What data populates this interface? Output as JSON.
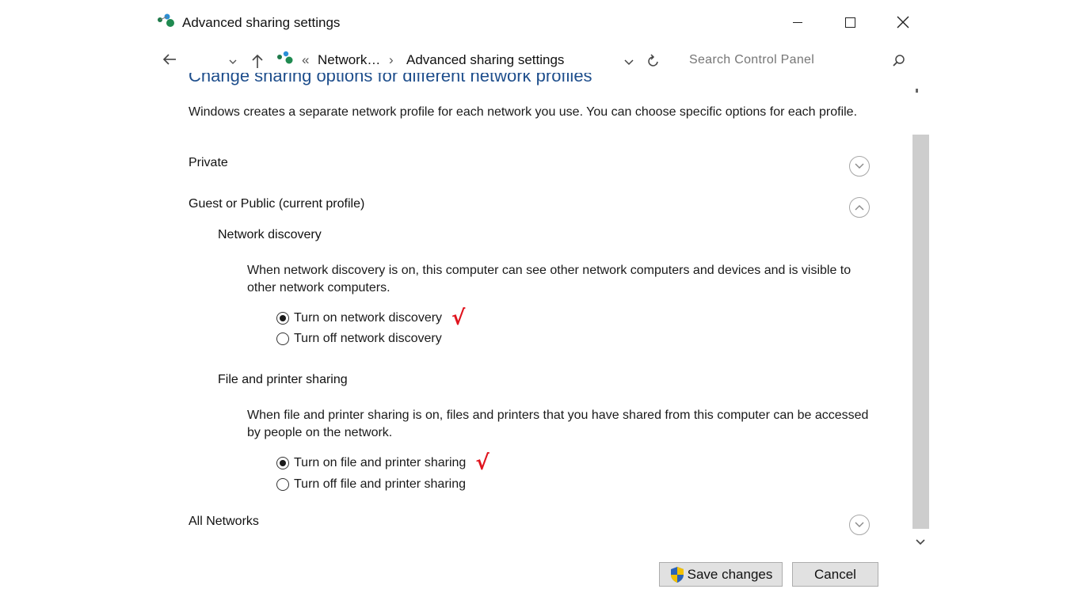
{
  "window": {
    "title": "Advanced sharing settings",
    "icon": "network-sharing-icon",
    "controls": [
      "minimize-icon",
      "maximize-icon",
      "close-icon"
    ]
  },
  "address_bar": {
    "overflow": "«",
    "crumbs": [
      "Network…",
      "Advanced sharing settings"
    ],
    "separator": "›",
    "search_placeholder": "Search Control Panel"
  },
  "page": {
    "heading": "Change sharing options for different network profiles",
    "intro": "Windows creates a separate network profile for each network you use. You can choose specific options for each profile.",
    "profiles": {
      "private": "Private",
      "guest": "Guest or Public (current profile)",
      "all": "All Networks"
    },
    "network_discovery": {
      "title": "Network discovery",
      "description": "When network discovery is on, this computer can see other network computers and devices and is visible to other network computers.",
      "option_on": "Turn on network discovery",
      "option_off": "Turn off network discovery",
      "selected": "on"
    },
    "file_sharing": {
      "title": "File and printer sharing",
      "description": "When file and printer sharing is on, files and printers that you have shared from this computer can be accessed by people on the network.",
      "option_on": "Turn on file and printer sharing",
      "option_off": "Turn off file and printer sharing",
      "selected": "on"
    },
    "checkmark": "√"
  },
  "footer": {
    "save_label": "Save changes",
    "cancel_label": "Cancel"
  },
  "colors": {
    "heading": "#1e4e8c",
    "checkmark": "#e0141e",
    "scrollbar": "#cdcdcd",
    "button_bg": "#e1e1e1"
  }
}
